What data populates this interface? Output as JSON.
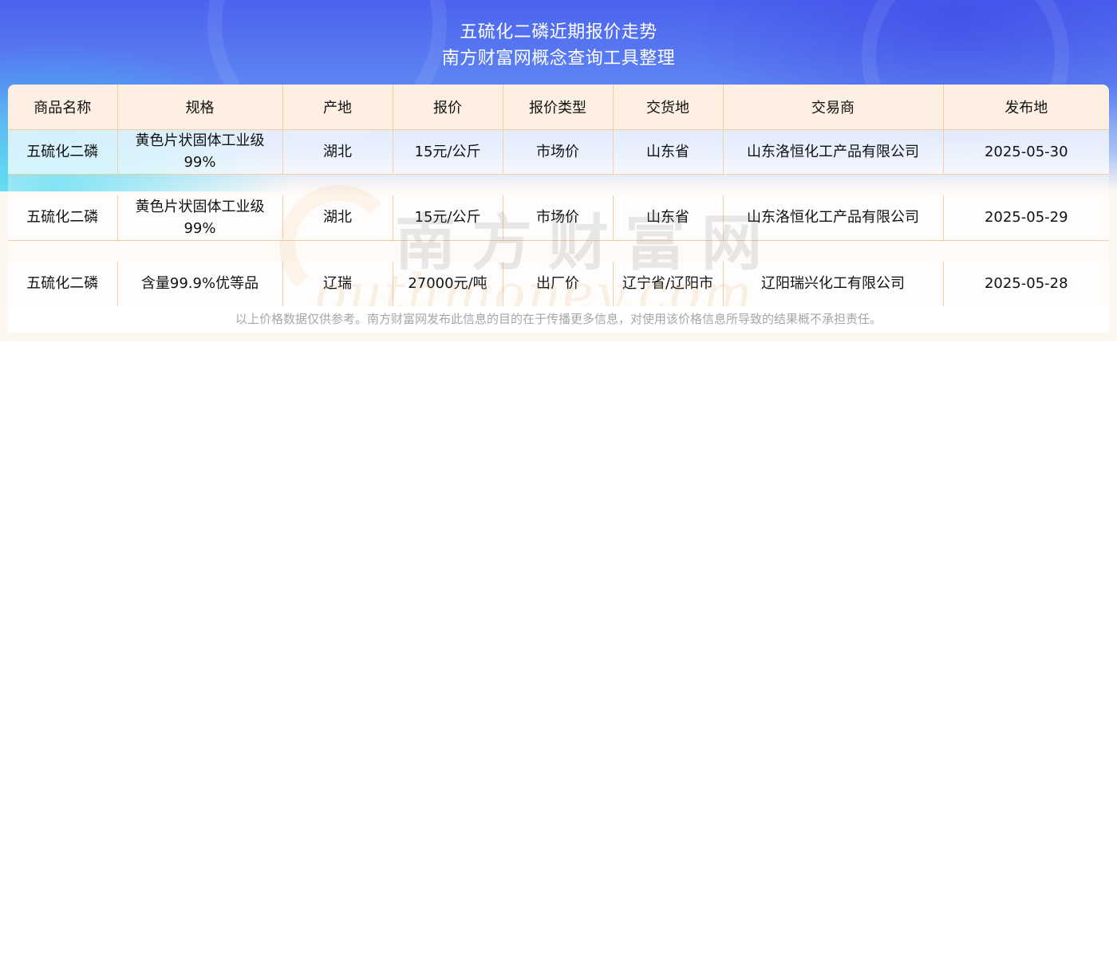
{
  "header": {
    "title_line1": "五硫化二磷近期报价走势",
    "title_line2": "南方财富网概念查询工具整理"
  },
  "chart_data": {
    "type": "table",
    "columns": [
      "商品名称",
      "规格",
      "产地",
      "报价",
      "报价类型",
      "交货地",
      "交易商",
      "发布地"
    ],
    "rows": [
      [
        "五硫化二磷",
        "黄色片状固体工业级99%",
        "湖北",
        "15元/公斤",
        "市场价",
        "山东省",
        "山东洛恒化工产品有限公司",
        "2025-05-30"
      ],
      [
        "五硫化二磷",
        "黄色片状固体工业级99%",
        "湖北",
        "15元/公斤",
        "市场价",
        "山东省",
        "山东洛恒化工产品有限公司",
        "2025-05-29"
      ],
      [
        "五硫化二磷",
        "含量99.9%优等品",
        "辽瑞",
        "27000元/吨",
        "出厂价",
        "辽宁省/辽阳市",
        "辽阳瑞兴化工有限公司",
        "2025-05-28"
      ]
    ]
  },
  "watermark": {
    "cn": "南方财富网",
    "en": "outhmoney.com"
  },
  "footer": {
    "disclaimer": "以上价格数据仅供参考。南方财富网发布此信息的目的在于传播更多信息，对使用该价格信息所导致的结果概不承担责任。"
  },
  "colors": {
    "banner_top": "#4b63ef",
    "banner_accent": "#28d2f0",
    "header_bg": "#fdefe1",
    "border": "#f2cfa5",
    "disclaimer_text": "#a6a6a6"
  }
}
